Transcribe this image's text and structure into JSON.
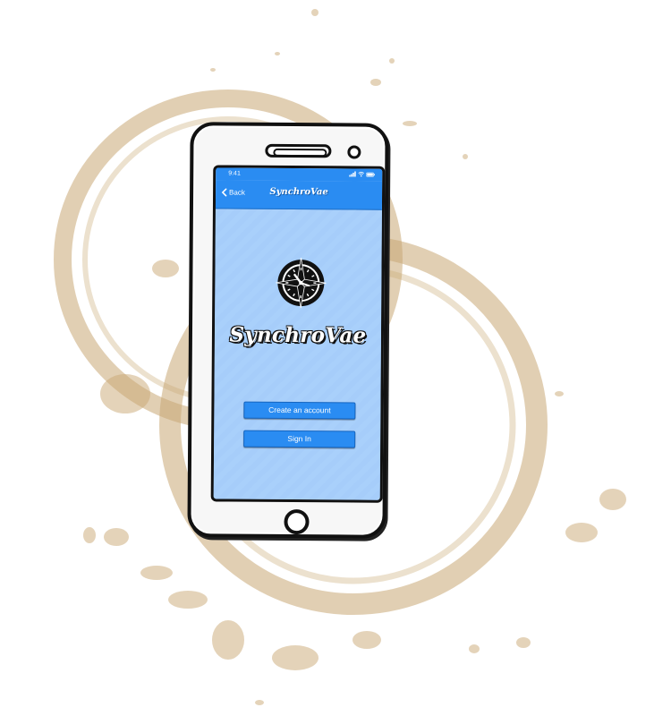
{
  "status_bar": {
    "time": "9:41",
    "icons": [
      "signal-icon",
      "wifi-icon",
      "battery-icon"
    ]
  },
  "nav": {
    "back_label": "Back",
    "back_icon": "chevron-left-icon",
    "title": "SynchroVae"
  },
  "main": {
    "logo_icon": "compass-clock-icon",
    "app_name": "SynchroVae",
    "create_account_label": "Create an account",
    "sign_in_label": "Sign In"
  },
  "colors": {
    "brand_blue": "#2a8cf2",
    "screen_background": "#a9cffb",
    "coffee_stain": "#c9a874"
  }
}
